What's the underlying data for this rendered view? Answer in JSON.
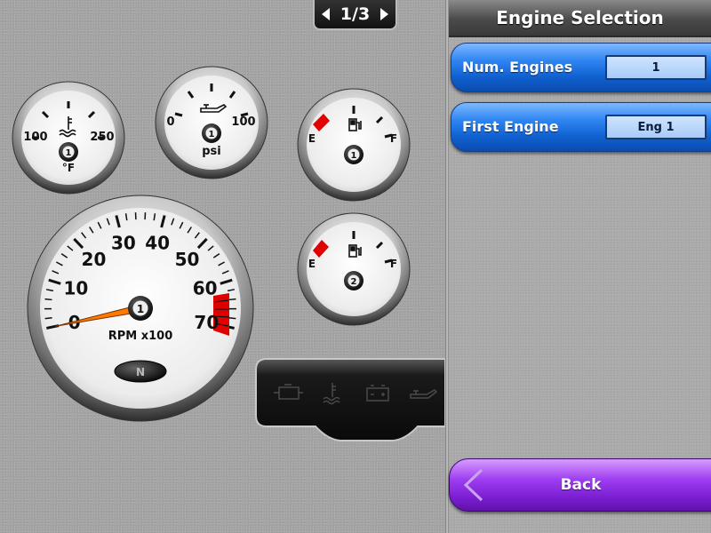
{
  "page_indicator": {
    "label": "1/3"
  },
  "panel": {
    "title": "Engine Selection",
    "settings": [
      {
        "label": "Num. Engines",
        "value": "1"
      },
      {
        "label": "First Engine",
        "value": "Eng 1"
      }
    ],
    "back_label": "Back"
  },
  "gauges": {
    "temperature": {
      "min_label": "100",
      "max_label": "250",
      "unit": "°F",
      "engine": "1"
    },
    "oil_pressure": {
      "min_label": "0",
      "max_label": "100",
      "unit": "psi",
      "engine": "1"
    },
    "fuel_1": {
      "empty_label": "E",
      "full_label": "F",
      "engine": "1"
    },
    "fuel_2": {
      "empty_label": "E",
      "full_label": "F",
      "engine": "2"
    },
    "tachometer": {
      "ticks": [
        "0",
        "10",
        "20",
        "30",
        "40",
        "50",
        "60",
        "70"
      ],
      "unit": "RPM x100",
      "engine": "1",
      "gear": "N",
      "value": 0
    }
  },
  "warning_lights": [
    "check-engine-icon",
    "coolant-temp-icon",
    "battery-icon",
    "oil-pressure-icon"
  ],
  "colors": {
    "accent_blue": "#1a73e8",
    "back_purple": "#8a2be2",
    "redline": "#e00000",
    "needle": "#ff7a00"
  }
}
